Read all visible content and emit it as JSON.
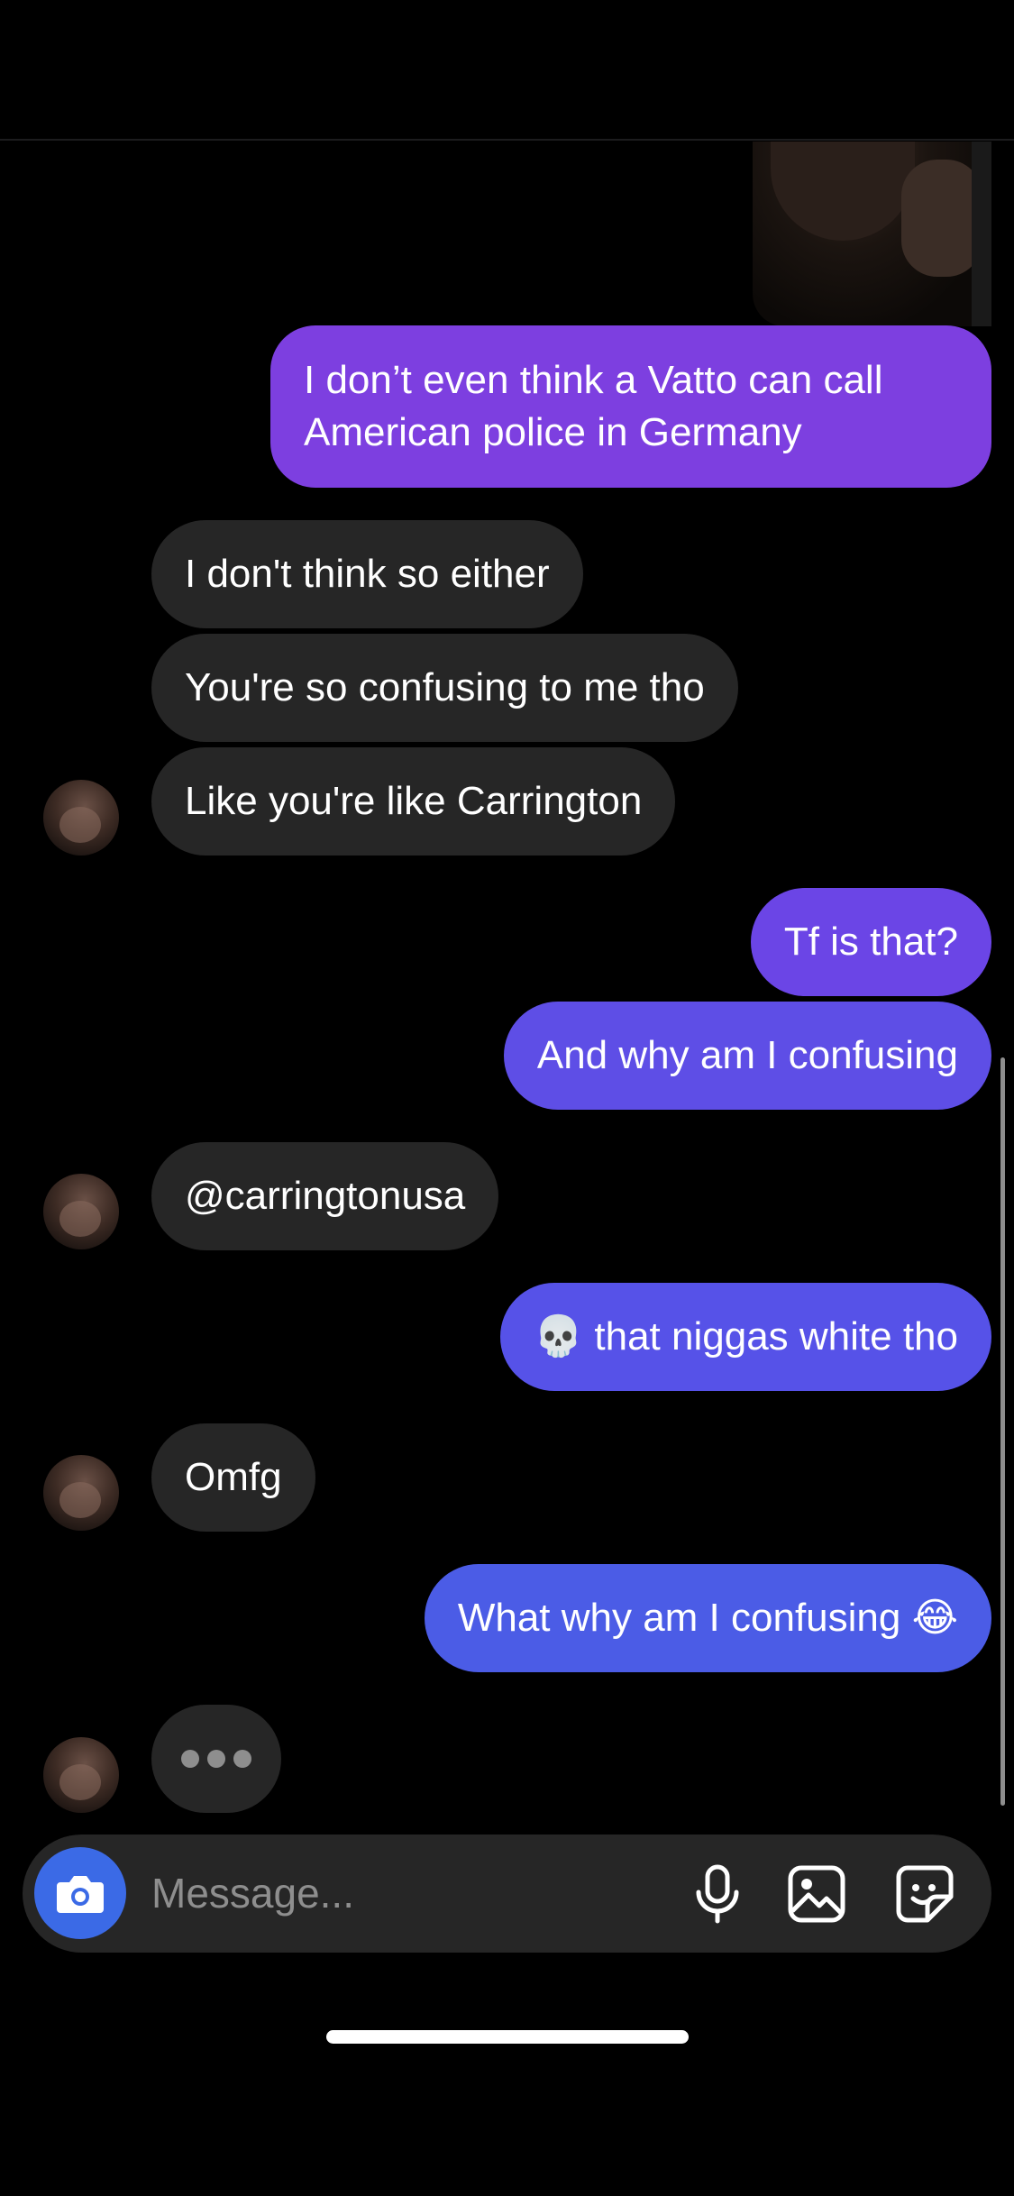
{
  "thread": {
    "messages": [
      {
        "from": "me",
        "text": "I don’t even think a Vatto can call American police in Germany"
      },
      {
        "from": "them",
        "text": "I don't think so either"
      },
      {
        "from": "them",
        "text": "You're so confusing to me tho"
      },
      {
        "from": "them",
        "text": "Like you're like Carrington"
      },
      {
        "from": "me",
        "text": "Tf is that?"
      },
      {
        "from": "me",
        "text": "And why am I confusing"
      },
      {
        "from": "them",
        "text": "@carringtonusa"
      },
      {
        "from": "me",
        "text": "💀 that niggas white tho"
      },
      {
        "from": "them",
        "text": "Omfg"
      },
      {
        "from": "me",
        "text": "What why am I confusing 😂"
      }
    ],
    "typing_indicator": true
  },
  "composer": {
    "placeholder": "Message...",
    "icons": [
      "camera-icon",
      "microphone-icon",
      "gallery-icon",
      "sticker-icon"
    ]
  },
  "colors": {
    "background": "#000000",
    "incoming_bubble": "#262626",
    "outgoing_gradient": [
      "#7d3fe0",
      "#7a3fe4",
      "#6b45e6",
      "#5e4ee6",
      "#5652e8",
      "#4b5ce6"
    ],
    "camera_button": "#3b6ae6"
  }
}
